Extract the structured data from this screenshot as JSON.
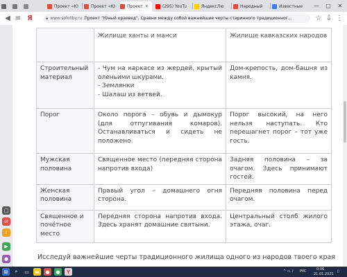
{
  "tabs": [
    {
      "label": "Проект «Ю",
      "color": "#e04a3f"
    },
    {
      "label": "Проект «Ю",
      "color": "#e04a3f"
    },
    {
      "label": "Проект",
      "color": "#e04a3f"
    },
    {
      "label": "(295) YouTu",
      "color": "#ff0000"
    },
    {
      "label": "ЯндексЛю",
      "color": "#ffcc00"
    },
    {
      "label": "Народный",
      "color": "#e04a3f"
    },
    {
      "label": "Известные",
      "color": "#3f7be0"
    }
  ],
  "window": {
    "minimize": "—",
    "maximize": "□",
    "close": "✕"
  },
  "address": {
    "back_icon": "◀",
    "yandex_letter": "Я",
    "domain": "www.sololiby.ru",
    "title": "Проект \"Юный краевед\". Сравни между собой важнейшие черты старинного традиционног..."
  },
  "page": {
    "cut_text": "",
    "header": {
      "col2": "Жилище ханты и манси",
      "col3": "Жилище кавказских народов"
    },
    "rows": [
      {
        "label": "Строительный материал",
        "col2": "- Чум на каркасе из жердей, крытый оленьими шкурами.\n- Землянки\n- Шалаш из ветвей.",
        "col3": "Дом-крепость, дом-башня из камня."
      },
      {
        "label": "Порог",
        "col2": "Около порога – обувь и дымокур (для отпугивания комаров). Останавливаться и сидеть не положено.",
        "col3": "Порог высокий, на него нельзя наступать. Кто перешагнет порог – тот уже гость."
      },
      {
        "label": "Мужская половина",
        "col2": "Священное место (передняя сторона напротив входа)",
        "col3": "Задняя половина – за очагом. Здесь принимают гостей."
      },
      {
        "label": "Женская половина",
        "col2": "Правый угол – домашнего огня сторона.",
        "col3": "Передняя половина перед очагом."
      },
      {
        "label": "Священное и почётное место",
        "col2": "Передняя сторона напротив входа. Здесь хранят домашние святыни.",
        "col3": "Центральный столб жилого этажа, очаг."
      }
    ],
    "footer": "Исследуй важнейшие черты традиционного жилища одного из народов твоего края (по"
  },
  "taskbar": {
    "time": "0:06",
    "date": "21.01.2021",
    "lang": "РУС"
  },
  "colors": {
    "tabbar": "#dfe1e5",
    "taskbar": "#1f2a44",
    "border": "#c8cdd2"
  }
}
